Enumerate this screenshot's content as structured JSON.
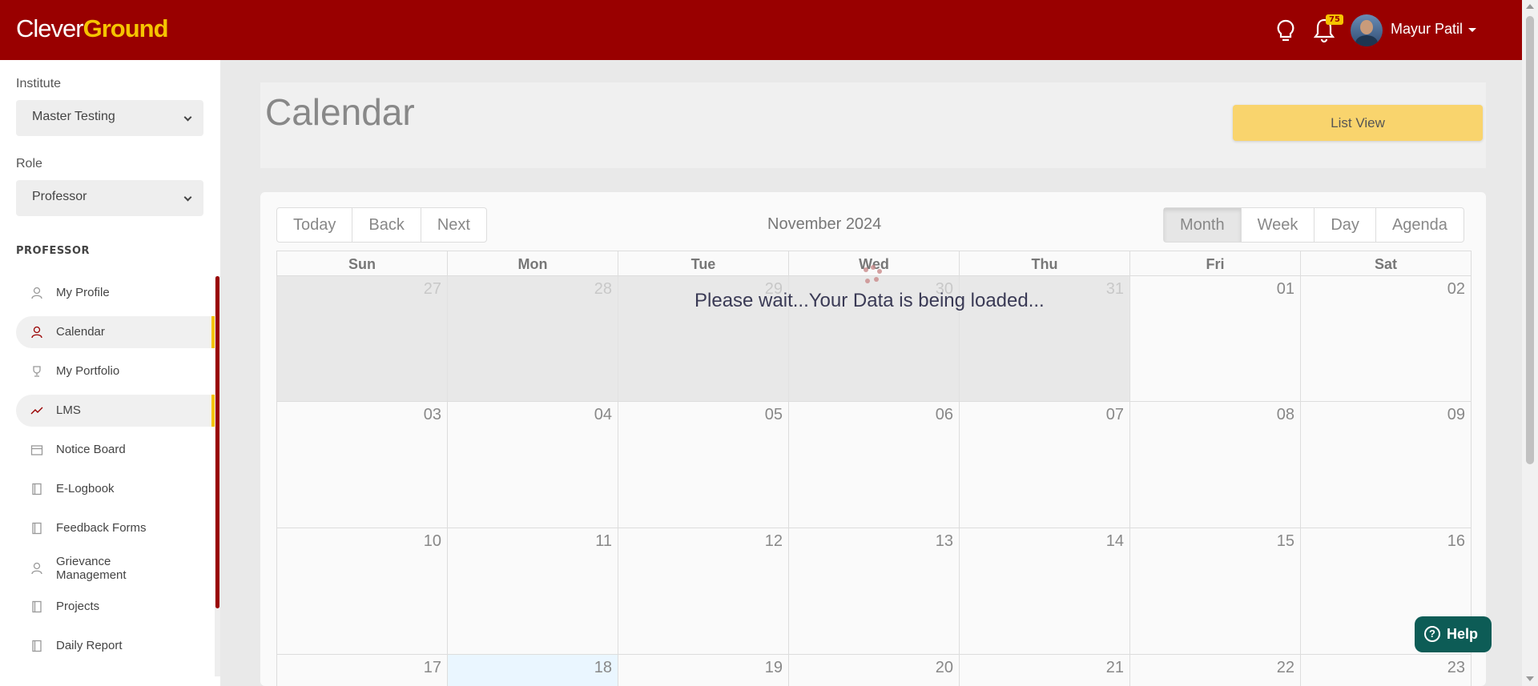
{
  "header": {
    "logo_part1": "Clever",
    "logo_part2": "Ground",
    "notification_count": "75",
    "user_name": "Mayur Patil"
  },
  "sidebar": {
    "institute_label": "Institute",
    "institute_value": "Master Testing",
    "role_label": "Role",
    "role_value": "Professor",
    "section_title": "PROFESSOR",
    "items": [
      {
        "label": "My Profile",
        "icon": "user-icon"
      },
      {
        "label": "Calendar",
        "icon": "user-icon",
        "active": true
      },
      {
        "label": "My Portfolio",
        "icon": "trophy-icon"
      },
      {
        "label": "LMS",
        "icon": "trend-icon",
        "active": true
      },
      {
        "label": "Notice Board",
        "icon": "calendar-icon"
      },
      {
        "label": "E-Logbook",
        "icon": "book-icon"
      },
      {
        "label": "Feedback Forms",
        "icon": "book-icon"
      },
      {
        "label": "Grievance Management",
        "icon": "user-icon"
      },
      {
        "label": "Projects",
        "icon": "book-icon"
      },
      {
        "label": "Daily Report",
        "icon": "book-icon"
      }
    ]
  },
  "main": {
    "title": "Calendar",
    "list_view_label": "List View",
    "nav_buttons": [
      "Today",
      "Back",
      "Next"
    ],
    "month_label": "November 2024",
    "view_buttons": [
      "Month",
      "Week",
      "Day",
      "Agenda"
    ],
    "active_view": "Month",
    "weekdays": [
      "Sun",
      "Mon",
      "Tue",
      "Wed",
      "Thu",
      "Fri",
      "Sat"
    ],
    "weeks": [
      [
        "27",
        "28",
        "29",
        "30",
        "31",
        "01",
        "02"
      ],
      [
        "03",
        "04",
        "05",
        "06",
        "07",
        "08",
        "09"
      ],
      [
        "10",
        "11",
        "12",
        "13",
        "14",
        "15",
        "16"
      ],
      [
        "17",
        "18",
        "19",
        "20",
        "21",
        "22",
        "23"
      ]
    ],
    "loading_message": "Please wait...Your Data is being loaded..."
  },
  "help_label": "Help",
  "colors": {
    "brand_red": "#990000",
    "brand_yellow": "#f5c400",
    "list_view_bg": "#f9d46d",
    "help_bg": "#0d5c56"
  }
}
